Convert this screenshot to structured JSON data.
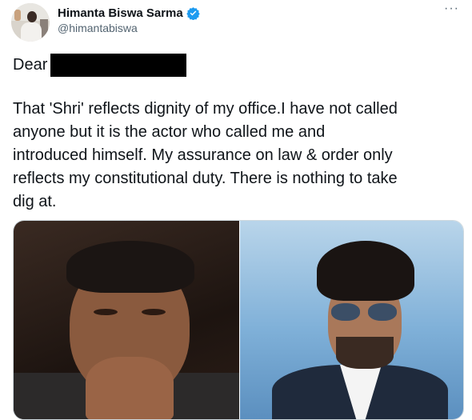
{
  "author": {
    "name": "Himanta Biswa Sarma",
    "handle": "@himantabiswa",
    "verified": true
  },
  "menu": {
    "more_label": "···"
  },
  "tweet": {
    "greeting": "Dear",
    "body": "That 'Shri' reflects dignity of my office.I have not called\nanyone but it is the actor who called me and\nintroduced himself. My assurance on law & order only\nreflects my constitutional duty. There is nothing to take\ndig at."
  },
  "colors": {
    "text": "#0f1419",
    "secondary": "#536471",
    "verified_badge": "#1d9bf0",
    "redaction": "#000000"
  },
  "icons": {
    "verified": "verified-badge-icon",
    "more": "more-options-icon"
  }
}
